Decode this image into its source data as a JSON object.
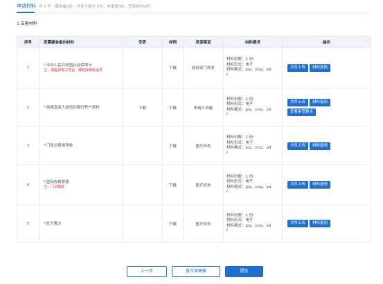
{
  "header": {
    "title": "申请材料",
    "summary": "共 5 份（需自备5份，可免于提交 0份，申请表0份，签章材料0份）"
  },
  "section_title": "1 自备材料",
  "table": {
    "headers": [
      "序号",
      "您需要准备的材料",
      "空表",
      "样例",
      "来源渠道",
      "材料要求",
      "操作"
    ],
    "rows": [
      {
        "index": "1",
        "star": "*",
        "name": "中华人民共和国社会保障卡",
        "note": "注：或医保电子凭证、或有效身份证件",
        "blank_form": "",
        "sample": "下载",
        "source": "政府部门核发",
        "req_line1": "材料份数：1 份",
        "req_line2": "材料形式：电子",
        "req_line3": "材料格式：jpg、png、pd",
        "req_line4": "f",
        "btn_upload": "文件上传",
        "btn_reuse": "材料复用",
        "btn_extra": ""
      },
      {
        "index": "2",
        "star": "*",
        "name": "待遇享受人提供的银行账户资料",
        "note": "",
        "blank_form": "下载",
        "sample": "下载",
        "source": "申请人自备",
        "req_line1": "材料份数：1 份",
        "req_line2": "材料形式：电子",
        "req_line3": "材料格式：jpg、png、pd",
        "req_line4": "f",
        "btn_upload": "文件上传",
        "btn_reuse": "材料复用",
        "btn_extra": "查看审查要点"
      },
      {
        "index": "3",
        "star": "*",
        "name": "门急诊费用清单",
        "note": "",
        "blank_form": "",
        "sample": "下载",
        "source": "医疗机构",
        "req_line1": "材料份数：1 份",
        "req_line2": "材料形式：电子",
        "req_line3": "材料格式：jpg、png、pd",
        "req_line4": "f",
        "btn_upload": "文件上传",
        "btn_reuse": "材料复用",
        "btn_extra": ""
      },
      {
        "index": "4",
        "star": "*",
        "name": "医院收费票据",
        "note": "注：门诊相关",
        "blank_form": "",
        "sample": "下载",
        "source": "医疗机构",
        "req_line1": "材料份数：1 份",
        "req_line2": "材料形式：电子",
        "req_line3": "材料格式：jpg、png、pd",
        "req_line4": "f",
        "btn_upload": "文件上传",
        "btn_reuse": "材料复用",
        "btn_extra": ""
      },
      {
        "index": "5",
        "star": "*",
        "name": "处方笺方",
        "note": "",
        "blank_form": "",
        "sample": "下载",
        "source": "医疗机构",
        "req_line1": "材料份数：1 份",
        "req_line2": "材料形式：电子",
        "req_line3": "材料格式：jpg、png、pd",
        "req_line4": "f",
        "btn_upload": "文件上传",
        "btn_reuse": "材料复用",
        "btn_extra": ""
      }
    ]
  },
  "footer": {
    "prev": "上一步",
    "save": "暂存草稿箱",
    "submit": "提交"
  },
  "colors": {
    "accent": "#1f6fd1",
    "required": "#e02020",
    "header_bg": "#eef3f9"
  }
}
